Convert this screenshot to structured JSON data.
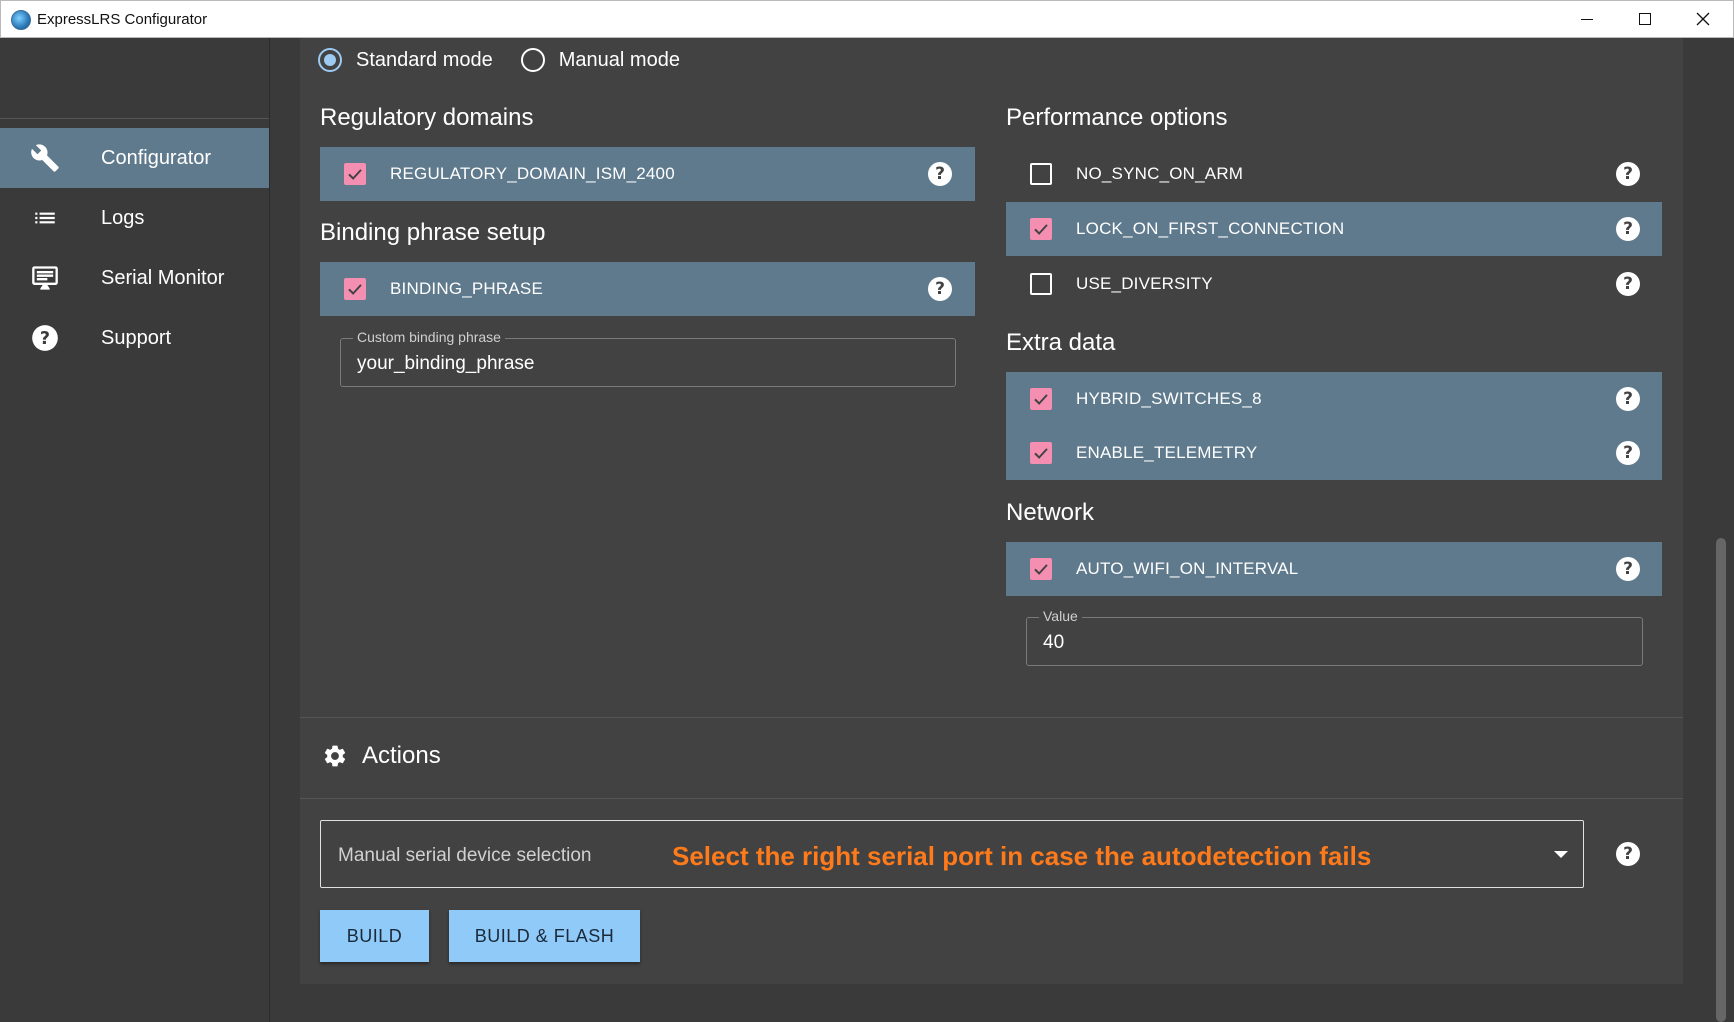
{
  "window": {
    "title": "ExpressLRS Configurator"
  },
  "sidebar": {
    "items": [
      {
        "label": "Configurator",
        "icon": "wrench-icon",
        "active": true
      },
      {
        "label": "Logs",
        "icon": "list-icon",
        "active": false
      },
      {
        "label": "Serial Monitor",
        "icon": "monitor-icon",
        "active": false
      },
      {
        "label": "Support",
        "icon": "help-circle-icon",
        "active": false
      }
    ]
  },
  "mode": {
    "options": [
      {
        "label": "Standard mode",
        "checked": true
      },
      {
        "label": "Manual mode",
        "checked": false
      }
    ]
  },
  "regulatory": {
    "title": "Regulatory domains",
    "options": [
      {
        "label": "REGULATORY_DOMAIN_ISM_2400",
        "checked": true
      }
    ]
  },
  "binding": {
    "title": "Binding phrase setup",
    "options": [
      {
        "label": "BINDING_PHRASE",
        "checked": true
      }
    ],
    "field_label": "Custom binding phrase",
    "field_value": "your_binding_phrase"
  },
  "performance": {
    "title": "Performance options",
    "options": [
      {
        "label": "NO_SYNC_ON_ARM",
        "checked": false
      },
      {
        "label": "LOCK_ON_FIRST_CONNECTION",
        "checked": true
      },
      {
        "label": "USE_DIVERSITY",
        "checked": false
      }
    ]
  },
  "extra": {
    "title": "Extra data",
    "options": [
      {
        "label": "HYBRID_SWITCHES_8",
        "checked": true
      },
      {
        "label": "ENABLE_TELEMETRY",
        "checked": true
      }
    ]
  },
  "network": {
    "title": "Network",
    "options": [
      {
        "label": "AUTO_WIFI_ON_INTERVAL",
        "checked": true
      }
    ],
    "field_label": "Value",
    "field_value": "40"
  },
  "actions": {
    "title": "Actions",
    "serial_select_label": "Manual serial device selection",
    "serial_hint": "Select the right serial port in case the autodetection fails",
    "build_label": "BUILD",
    "build_flash_label": "BUILD & FLASH"
  },
  "colors": {
    "accent": "#90caf9",
    "checkbox": "#f48fb1",
    "selected_row": "#5f7a8c",
    "hint": "#ff7a1a"
  }
}
